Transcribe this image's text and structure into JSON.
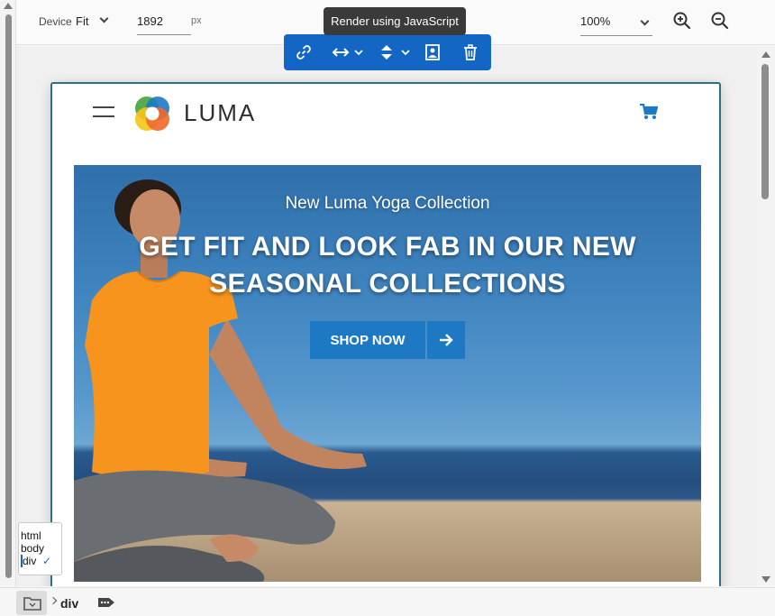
{
  "toolbar": {
    "device_label": "Device",
    "device_value": "Fit",
    "width_value": "1892",
    "width_unit": "px",
    "zoom_value": "100%",
    "tooltip": "Render using JavaScript"
  },
  "selection_toolbar": {
    "icons": [
      "link-icon",
      "horizontal-resize-icon",
      "vertical-resize-icon",
      "image-placeholder-icon",
      "delete-icon"
    ]
  },
  "site": {
    "brand": "LUMA",
    "hero": {
      "subtitle": "New Luma Yoga Collection",
      "title": "GET FIT AND LOOK FAB IN OUR NEW SEASONAL COLLECTIONS",
      "button_label": "SHOP NOW"
    }
  },
  "picker": {
    "items": [
      "html",
      "body",
      "div"
    ],
    "selected": "div"
  },
  "breadcrumb": {
    "current": "div"
  },
  "colors": {
    "accent": "#1466c4",
    "hero_button": "#1d79c4",
    "device_border": "#2d6f84"
  }
}
